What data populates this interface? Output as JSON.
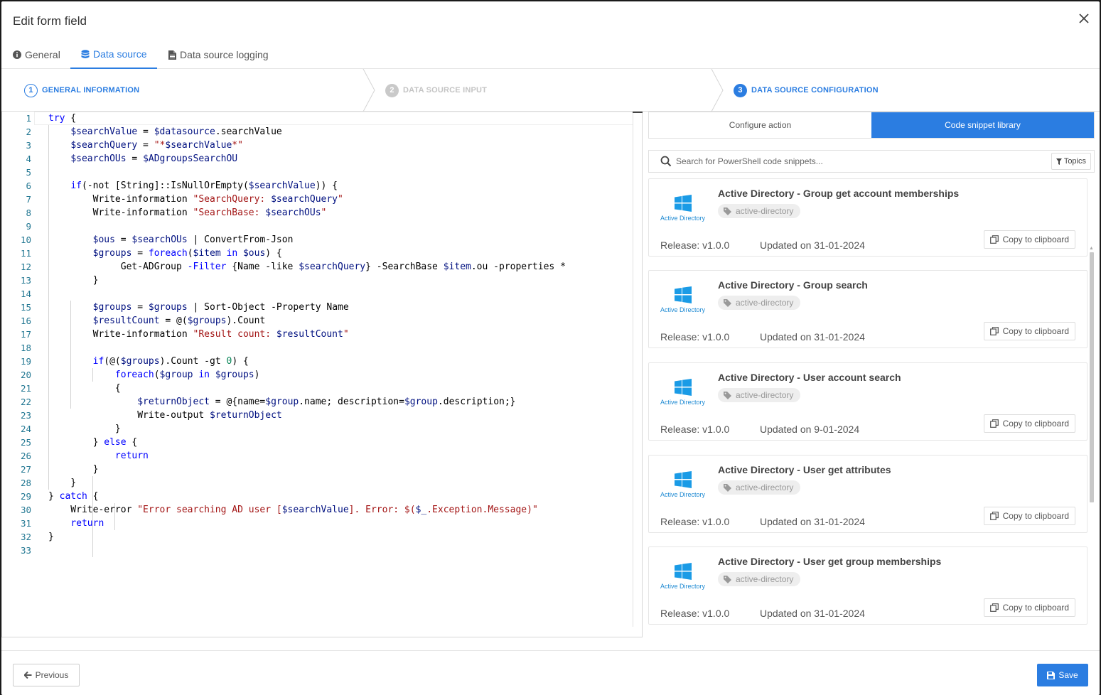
{
  "header": {
    "title": "Edit form field"
  },
  "tabs": [
    {
      "label": "General",
      "icon": "info-circle-icon"
    },
    {
      "label": "Data source",
      "icon": "database-icon",
      "active": true
    },
    {
      "label": "Data source logging",
      "icon": "file-icon"
    }
  ],
  "steps": [
    {
      "num": "1",
      "label": "GENERAL INFORMATION",
      "state": "done"
    },
    {
      "num": "2",
      "label": "DATA SOURCE INPUT",
      "state": "pending"
    },
    {
      "num": "3",
      "label": "DATA SOURCE CONFIGURATION",
      "state": "current"
    }
  ],
  "editor": {
    "line_numbers": [
      "1",
      "2",
      "3",
      "4",
      "5",
      "6",
      "7",
      "8",
      "9",
      "10",
      "11",
      "12",
      "13",
      "14",
      "15",
      "16",
      "17",
      "18",
      "19",
      "20",
      "21",
      "22",
      "23",
      "24",
      "25",
      "26",
      "27",
      "28",
      "29",
      "30",
      "31",
      "32",
      "33"
    ]
  },
  "panel": {
    "configure_label": "Configure action",
    "library_label": "Code snippet library",
    "search_placeholder": "Search for PowerShell code snippets...",
    "topics_label": "Topics",
    "logo_text": "Active Directory",
    "cards": [
      {
        "title": "Active Directory - Group get account memberships",
        "tag": "active-directory",
        "release": "Release: v1.0.0",
        "updated": "Updated on 31-01-2024",
        "copy": "Copy to clipboard"
      },
      {
        "title": "Active Directory - Group search",
        "tag": "active-directory",
        "release": "Release: v1.0.0",
        "updated": "Updated on 31-01-2024",
        "copy": "Copy to clipboard"
      },
      {
        "title": "Active Directory - User account search",
        "tag": "active-directory",
        "release": "Release: v1.0.0",
        "updated": "Updated on 9-01-2024",
        "copy": "Copy to clipboard"
      },
      {
        "title": "Active Directory - User get attributes",
        "tag": "active-directory",
        "release": "Release: v1.0.0",
        "updated": "Updated on 31-01-2024",
        "copy": "Copy to clipboard"
      },
      {
        "title": "Active Directory - User get group memberships",
        "tag": "active-directory",
        "release": "Release: v1.0.0",
        "updated": "Updated on 31-01-2024",
        "copy": "Copy to clipboard"
      }
    ]
  },
  "footer": {
    "previous_label": "Previous",
    "save_label": "Save"
  },
  "colors": {
    "accent": "#2b7de1",
    "keyword": "#0000ff",
    "string": "#a31515",
    "variable": "#001080"
  }
}
